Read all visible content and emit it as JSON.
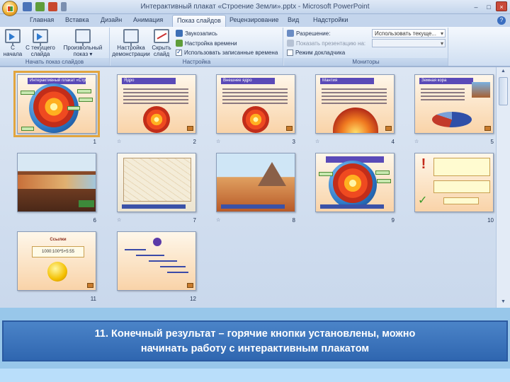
{
  "window": {
    "title": "Интерактивный плакат «Строение Земли».pptx - Microsoft PowerPoint",
    "controls": [
      "–",
      "□",
      "×"
    ]
  },
  "tabs": [
    {
      "label": "Главная",
      "active": false
    },
    {
      "label": "Вставка",
      "active": false
    },
    {
      "label": "Дизайн",
      "active": false
    },
    {
      "label": "Анимация",
      "active": false
    },
    {
      "label": "Показ слайдов",
      "active": true
    },
    {
      "label": "Рецензирование",
      "active": false
    },
    {
      "label": "Вид",
      "active": false
    },
    {
      "label": "Надстройки",
      "active": false
    }
  ],
  "ribbon": {
    "group1": {
      "label": "Начать показ слайдов",
      "from_start": [
        "С",
        "начала"
      ],
      "from_current": [
        "С текущего",
        "слайда"
      ],
      "custom": [
        "Произвольный",
        "показ ▾"
      ]
    },
    "group2": {
      "label": "Настройка",
      "setup": [
        "Настройка",
        "демонстрации"
      ],
      "hide": [
        "Скрыть",
        "слайд"
      ],
      "record": "Звукозапись",
      "timings": "Настройка времени",
      "use_timings": "Использовать записанные времена"
    },
    "group3": {
      "label": "Мониторы",
      "resolution_label": "Разрешение:",
      "resolution_value": "Использовать текуще...",
      "show_on_label": "Показать презентацию на:",
      "presenter_view": "Режим докладчика"
    }
  },
  "slides": {
    "numbers": [
      "1",
      "2",
      "3",
      "4",
      "5",
      "6",
      "7",
      "8",
      "9",
      "10",
      "11",
      "12"
    ],
    "selected": "1",
    "titles": {
      "s1": "Интерактивный плакат «Строение Земли»",
      "s2": "Ядро",
      "s3": "Внешнее ядро",
      "s4": "Мантия",
      "s5": "Земная кора",
      "s11_head": "Ссылки",
      "s11_text": "1000:100*5+5:55"
    }
  },
  "caption": {
    "line1": "11. Конечный результат – горячие кнопки установлены, можно",
    "line2": "начинать работу с интерактивным плакатом"
  }
}
